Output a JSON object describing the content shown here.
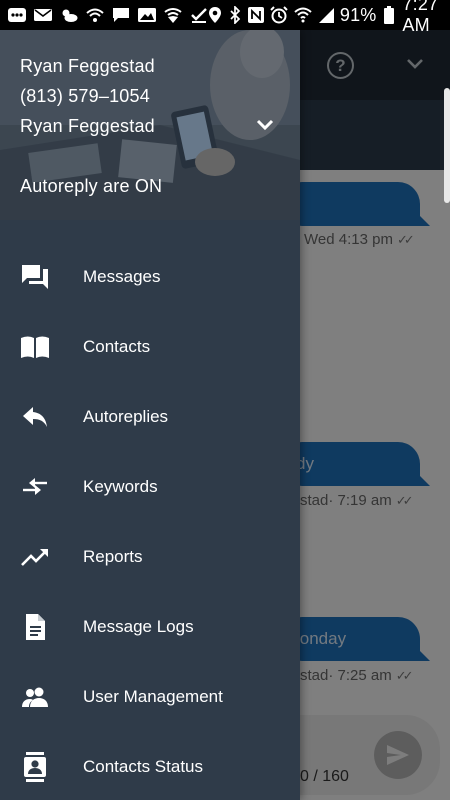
{
  "status_bar": {
    "battery_percent": "91%",
    "time": "7:27 AM"
  },
  "drawer": {
    "account": {
      "name": "Ryan Feggestad",
      "phone": "(813) 579–1054",
      "selected_account": "Ryan Feggestad",
      "autoreply_status": "Autoreply are ON"
    },
    "menu": [
      {
        "label": "Messages",
        "icon": "chat-icon"
      },
      {
        "label": "Contacts",
        "icon": "book-icon"
      },
      {
        "label": "Autoreplies",
        "icon": "reply-icon"
      },
      {
        "label": "Keywords",
        "icon": "compare-arrows-icon"
      },
      {
        "label": "Reports",
        "icon": "trending-up-icon"
      },
      {
        "label": "Message Logs",
        "icon": "document-icon"
      },
      {
        "label": "User Management",
        "icon": "people-icon"
      },
      {
        "label": "Contacts Status",
        "icon": "contact-card-icon"
      }
    ]
  },
  "conversation": {
    "messages": [
      {
        "text": "",
        "meta": "Wed 4:13 pm"
      },
      {
        "text": "dy",
        "meta": "stad· 7:19 am"
      },
      {
        "text": "londay",
        "meta": "stad· 7:25 am"
      }
    ],
    "char_counter": "0 / 160"
  },
  "colors": {
    "drawer_bg": "#2f3b49",
    "bubble": "#1e6fb8",
    "app_bar": "#1f2a35"
  }
}
